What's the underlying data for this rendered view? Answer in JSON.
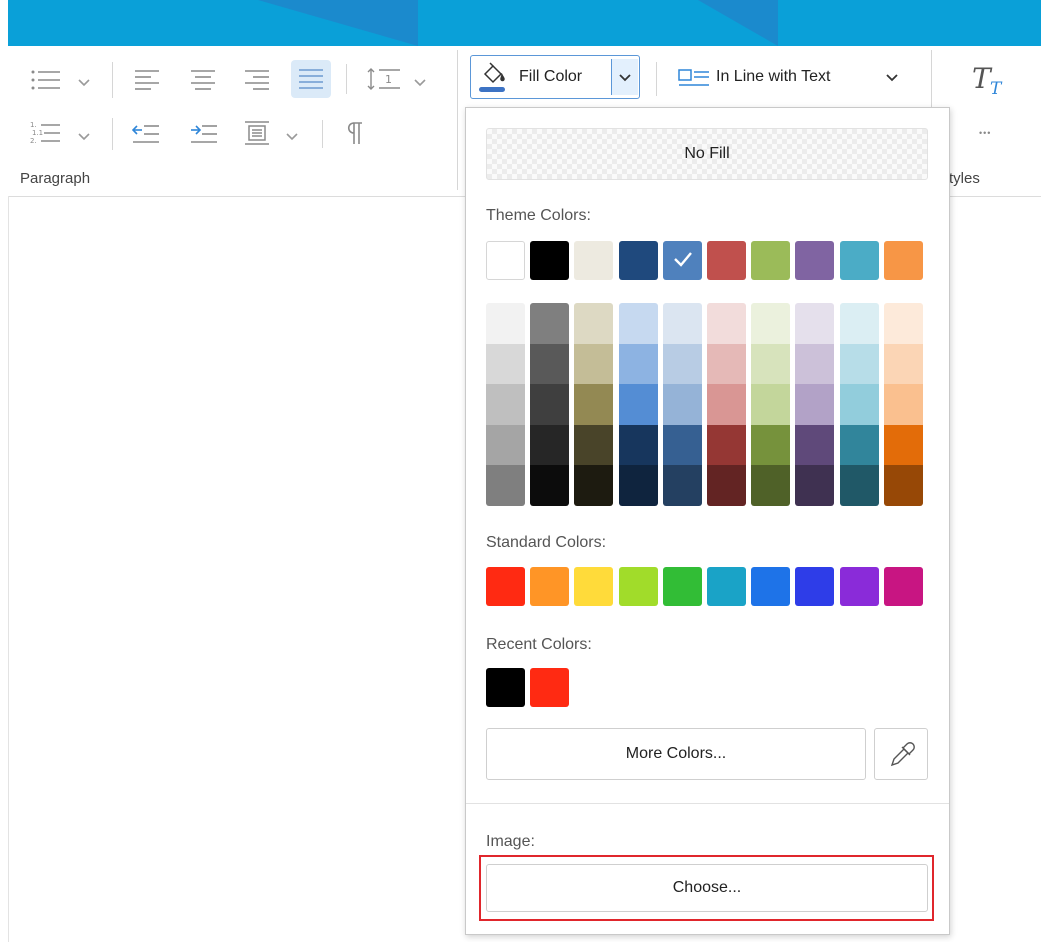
{
  "ribbon": {
    "paragraph_label": "Paragraph",
    "styles_label": "tyles",
    "fill_color_label": "Fill Color",
    "wrap_label": "In Line with Text",
    "more_glyph": "•••"
  },
  "popup": {
    "no_fill": "No Fill",
    "theme_label": "Theme Colors:",
    "standard_label": "Standard Colors:",
    "recent_label": "Recent Colors:",
    "more_colors": "More Colors...",
    "image_label": "Image:",
    "choose": "Choose...",
    "theme_colors": [
      "#ffffff",
      "#000000",
      "#edeae0",
      "#1f497d",
      "#4f81bd",
      "#c0504d",
      "#9bbb59",
      "#8064a2",
      "#4bacc6",
      "#f79646"
    ],
    "theme_selected_index": 4,
    "shades": [
      [
        "#f2f2f2",
        "#d8d8d8",
        "#bfbfbf",
        "#a5a5a5",
        "#7f7f7f"
      ],
      [
        "#7f7f7f",
        "#595959",
        "#3f3f3f",
        "#262626",
        "#0c0c0c"
      ],
      [
        "#ddd9c3",
        "#c4bd97",
        "#938953",
        "#494429",
        "#1d1b10"
      ],
      [
        "#c6d9f0",
        "#8db3e2",
        "#548dd4",
        "#17365d",
        "#0f243e"
      ],
      [
        "#dbe5f1",
        "#b8cce4",
        "#95b3d7",
        "#366092",
        "#244061"
      ],
      [
        "#f2dcdb",
        "#e5b9b7",
        "#d99694",
        "#953734",
        "#632423"
      ],
      [
        "#ebf1dd",
        "#d7e3bc",
        "#c3d69b",
        "#76923c",
        "#4f6128"
      ],
      [
        "#e5e0ec",
        "#ccc1d9",
        "#b2a2c7",
        "#5f497a",
        "#3f3151"
      ],
      [
        "#dbeef3",
        "#b7dde8",
        "#92cddc",
        "#31859b",
        "#205867"
      ],
      [
        "#fdeada",
        "#fbd5b5",
        "#fac08f",
        "#e36c09",
        "#974806"
      ]
    ],
    "standard_colors": [
      "#ff2a12",
      "#ff9526",
      "#ffdb3a",
      "#a1dc2a",
      "#32bd36",
      "#1aa3c7",
      "#1e73e8",
      "#2e3de8",
      "#8a2bd9",
      "#c81582"
    ],
    "recent_colors": [
      "#000000",
      "#ff2a12"
    ]
  }
}
